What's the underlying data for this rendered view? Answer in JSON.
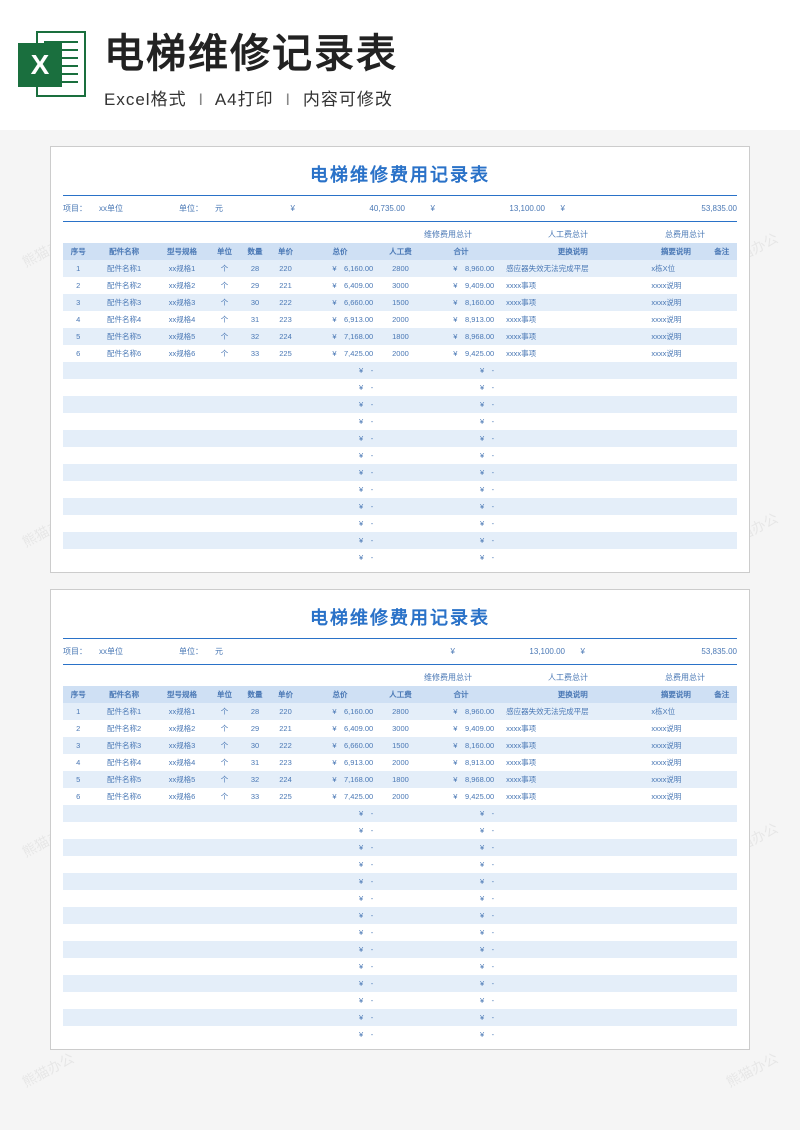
{
  "banner": {
    "title": "电梯维修记录表",
    "sub1": "Excel格式",
    "sub2": "A4打印",
    "sub3": "内容可修改",
    "icon_letter": "X"
  },
  "watermark": "熊猫办公",
  "sheet": {
    "title": "电梯维修费用记录表",
    "meta": {
      "proj_label": "项目：",
      "proj_val": "xx单位",
      "unit_label": "单位：",
      "unit_val": "元",
      "sym": "¥",
      "repair_total": "40,735.00",
      "labor_total": "13,100.00",
      "grand_total": "53,835.00",
      "repair_label": "维修费用总计",
      "labor_label": "人工费总计",
      "grand_label": "总费用总计"
    },
    "headers": [
      "序号",
      "配件名称",
      "型号规格",
      "单位",
      "数量",
      "单价",
      "总价",
      "人工费",
      "合计",
      "更换说明",
      "摘要说明",
      "备注"
    ],
    "rows": [
      {
        "idx": "1",
        "name": "配件名称1",
        "spec": "xx规格1",
        "u": "个",
        "qty": "28",
        "price": "220",
        "total": "6,160.00",
        "labor": "2800",
        "sum": "8,960.00",
        "reason": "感应器失效无法完成平层",
        "abs": "x栋X位",
        "note": ""
      },
      {
        "idx": "2",
        "name": "配件名称2",
        "spec": "xx规格2",
        "u": "个",
        "qty": "29",
        "price": "221",
        "total": "6,409.00",
        "labor": "3000",
        "sum": "9,409.00",
        "reason": "xxxx事项",
        "abs": "xxxx说明",
        "note": ""
      },
      {
        "idx": "3",
        "name": "配件名称3",
        "spec": "xx规格3",
        "u": "个",
        "qty": "30",
        "price": "222",
        "total": "6,660.00",
        "labor": "1500",
        "sum": "8,160.00",
        "reason": "xxxx事项",
        "abs": "xxxx说明",
        "note": ""
      },
      {
        "idx": "4",
        "name": "配件名称4",
        "spec": "xx规格4",
        "u": "个",
        "qty": "31",
        "price": "223",
        "total": "6,913.00",
        "labor": "2000",
        "sum": "8,913.00",
        "reason": "xxxx事项",
        "abs": "xxxx说明",
        "note": ""
      },
      {
        "idx": "5",
        "name": "配件名称5",
        "spec": "xx规格5",
        "u": "个",
        "qty": "32",
        "price": "224",
        "total": "7,168.00",
        "labor": "1800",
        "sum": "8,968.00",
        "reason": "xxxx事项",
        "abs": "xxxx说明",
        "note": ""
      },
      {
        "idx": "6",
        "name": "配件名称6",
        "spec": "xx规格6",
        "u": "个",
        "qty": "33",
        "price": "225",
        "total": "7,425.00",
        "labor": "2000",
        "sum": "9,425.00",
        "reason": "xxxx事项",
        "abs": "xxxx说明",
        "note": ""
      }
    ],
    "empty_symbol": "¥",
    "dash": "-",
    "empty_rows_upper": 12,
    "empty_rows_lower": 14
  }
}
